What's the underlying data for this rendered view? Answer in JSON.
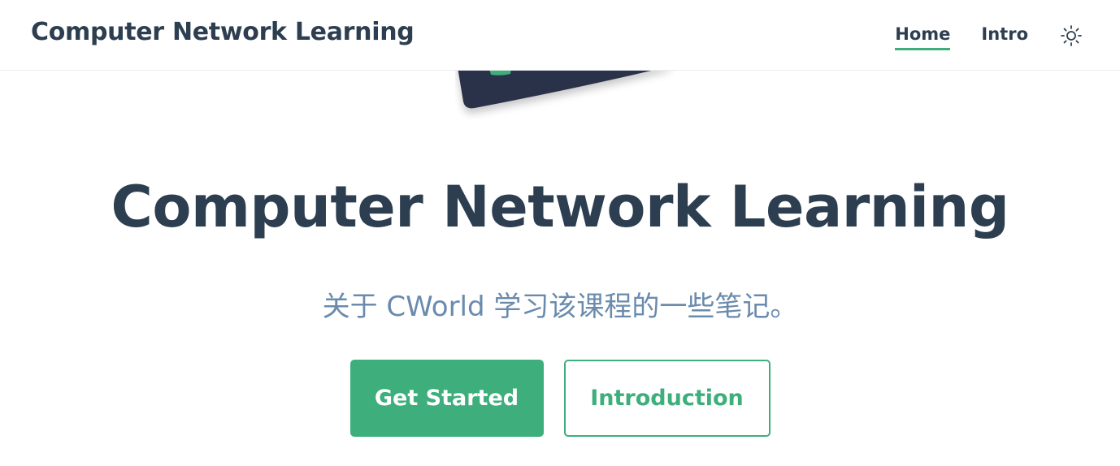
{
  "navbar": {
    "site_name": "Computer Network Learning",
    "links": [
      {
        "label": "Home",
        "active": true
      },
      {
        "label": "Intro",
        "active": false
      }
    ],
    "theme_toggle_icon": "sun-icon"
  },
  "hero": {
    "image_icon": "laptop-illustration",
    "title": "Computer Network Learning",
    "description": "关于 CWorld 学习该课程的一些笔记。",
    "actions": {
      "primary_label": "Get Started",
      "secondary_label": "Introduction"
    }
  },
  "colors": {
    "accent": "#3eaf7c",
    "text": "#2c3e50",
    "description": "#6a8bad"
  }
}
